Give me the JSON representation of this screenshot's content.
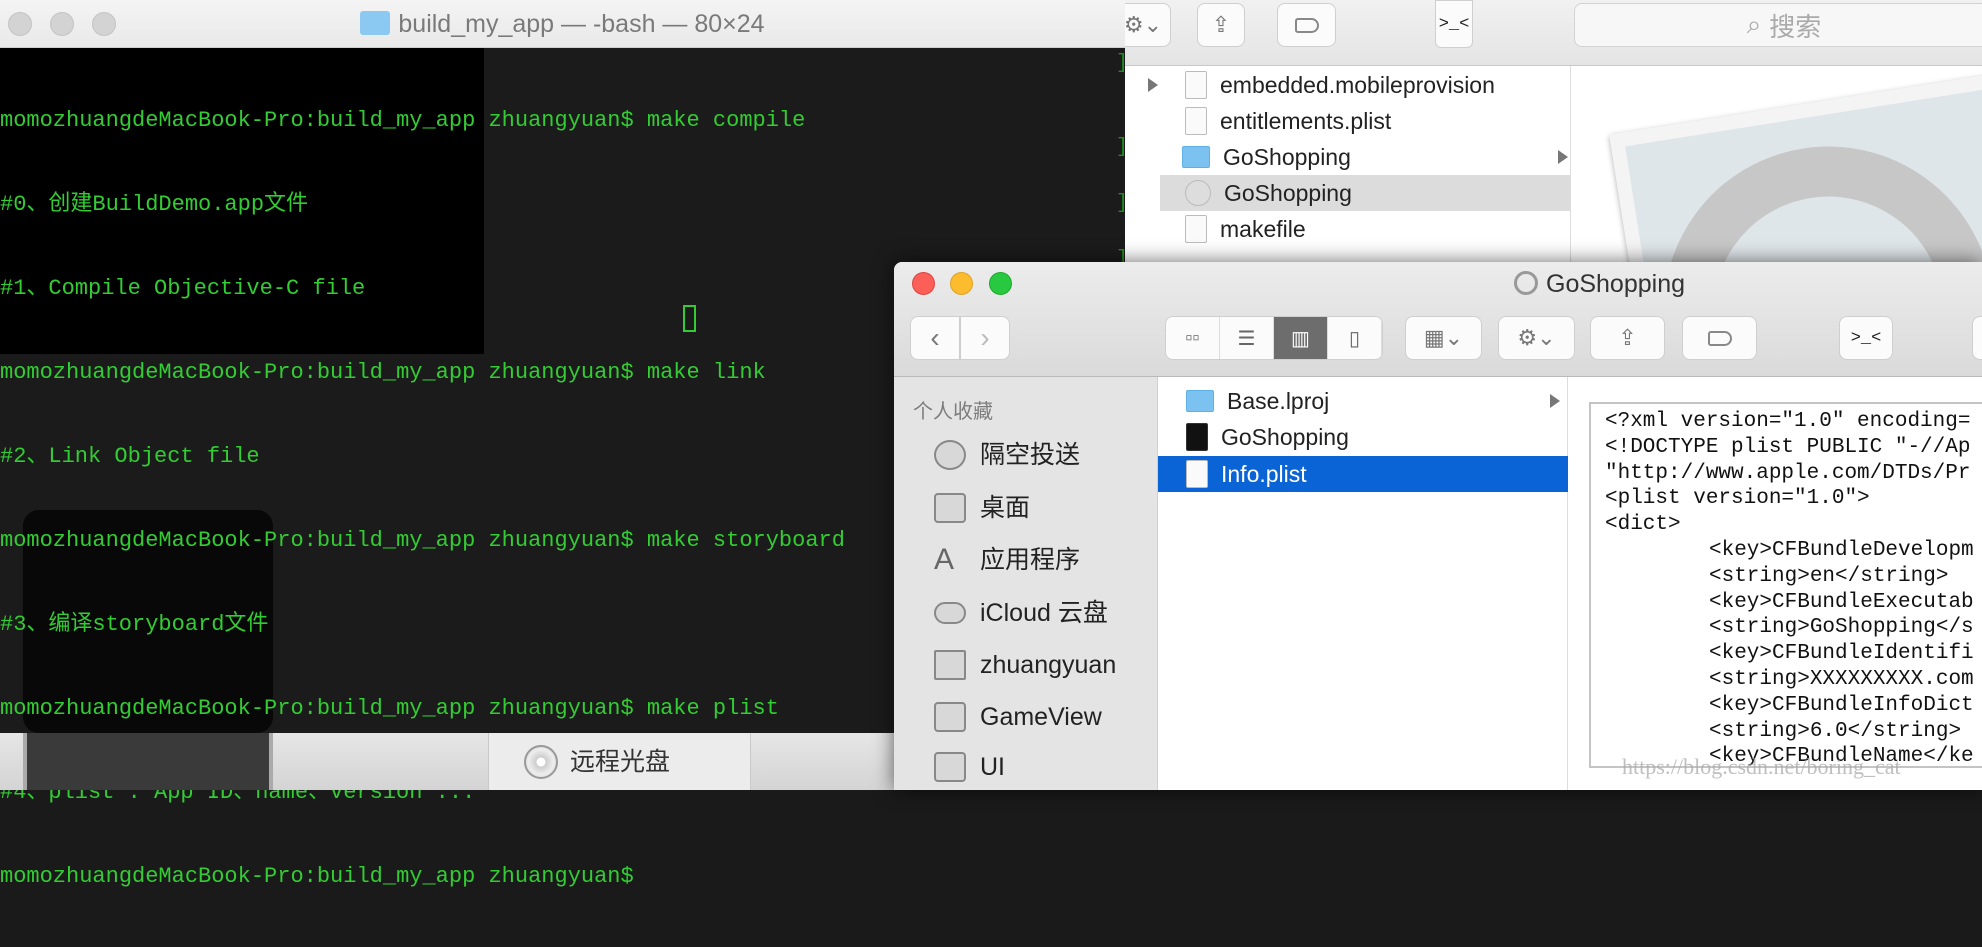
{
  "terminal": {
    "title": "build_my_app — -bash — 80×24",
    "lines": [
      "momozhuangdeMacBook-Pro:build_my_app zhuangyuan$ make compile",
      "#0、创建BuildDemo.app文件",
      "#1、Compile Objective-C file",
      "momozhuangdeMacBook-Pro:build_my_app zhuangyuan$ make link",
      "#2、Link Object file",
      "momozhuangdeMacBook-Pro:build_my_app zhuangyuan$ make storyboard",
      "#3、编译storyboard文件",
      "momozhuangdeMacBook-Pro:build_my_app zhuangyuan$ make plist",
      "#4、plist : App ID、name、version ...",
      "momozhuangdeMacBook-Pro:build_my_app zhuangyuan$ "
    ],
    "text_color": "#33cc33"
  },
  "background_finder": {
    "search_placeholder": "搜索",
    "terminal_button": ">_<",
    "files": [
      {
        "name": "embedded.mobileprovision",
        "icon": "provision-file-icon"
      },
      {
        "name": "entitlements.plist",
        "icon": "plist-file-icon"
      },
      {
        "name": "GoShopping",
        "icon": "folder-icon"
      },
      {
        "name": "GoShopping",
        "icon": "app-icon"
      },
      {
        "name": "makefile",
        "icon": "document-icon"
      }
    ]
  },
  "dock_strip": {
    "item": "远程光盘"
  },
  "finder": {
    "title": "GoShopping",
    "terminal_button": ">_<",
    "sidebar": {
      "header": "个人收藏",
      "items": [
        "隔空投送",
        "桌面",
        "应用程序",
        "iCloud 云盘",
        "zhuangyuan",
        "GameView",
        "UI"
      ]
    },
    "column1": [
      "Base.lproj",
      "GoShopping",
      "Info.plist"
    ],
    "plist_lines": [
      {
        "indent": false,
        "text": "<?xml version=\"1.0\" encoding="
      },
      {
        "indent": false,
        "text": "<!DOCTYPE plist PUBLIC \"-//Ap"
      },
      {
        "indent": false,
        "text": "\"http://www.apple.com/DTDs/Pr"
      },
      {
        "indent": false,
        "text": "<plist version=\"1.0\">"
      },
      {
        "indent": false,
        "text": "<dict>"
      },
      {
        "indent": true,
        "text": "<key>CFBundleDevelopm"
      },
      {
        "indent": true,
        "text": "<string>en</string>"
      },
      {
        "indent": true,
        "text": "<key>CFBundleExecutab"
      },
      {
        "indent": true,
        "text": "<string>GoShopping</s"
      },
      {
        "indent": true,
        "text": "<key>CFBundleIdentifi"
      },
      {
        "indent": true,
        "text": "<string>XXXXXXXXX.com"
      },
      {
        "indent": true,
        "text": "<key>CFBundleInfoDict"
      },
      {
        "indent": true,
        "text": "<string>6.0</string>"
      },
      {
        "indent": true,
        "text": "<key>CFBundleName</ke"
      }
    ],
    "selection_color": "#0a64d6"
  },
  "watermark": "https://blog.csdn.net/boring_cat"
}
